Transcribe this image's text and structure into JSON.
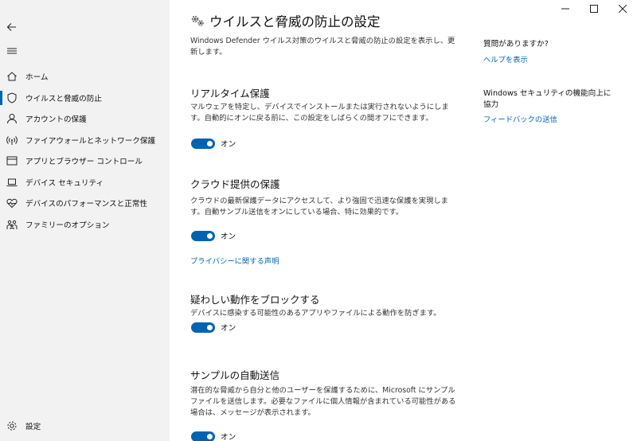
{
  "sidebar": {
    "back_label": "戻る",
    "items": [
      {
        "label": "ホーム",
        "icon": "home-icon"
      },
      {
        "label": "ウイルスと脅威の防止",
        "icon": "shield-icon"
      },
      {
        "label": "アカウントの保護",
        "icon": "person-icon"
      },
      {
        "label": "ファイアウォールとネットワーク保護",
        "icon": "wifi-icon"
      },
      {
        "label": "アプリとブラウザー コントロール",
        "icon": "browser-icon"
      },
      {
        "label": "デバイス セキュリティ",
        "icon": "laptop-icon"
      },
      {
        "label": "デバイスのパフォーマンスと正常性",
        "icon": "heart-icon"
      },
      {
        "label": "ファミリーのオプション",
        "icon": "family-icon"
      }
    ],
    "settings_label": "設定"
  },
  "main": {
    "title": "ウイルスと脅威の防止の設定",
    "description": "Windows Defender ウイルス対策のウイルスと脅威の防止の設定を表示し、更新します。",
    "sections": [
      {
        "title": "リアルタイム保護",
        "description": "マルウェアを特定し、デバイスでインストールまたは実行されないようにします。自動的にオンに戻る前に、この設定をしばらくの間オフにできます。",
        "toggle_label": "オン"
      },
      {
        "title": "クラウド提供の保護",
        "description": "クラウドの最新保護データにアクセスして、より強固で迅速な保護を実現します。自動サンプル送信をオンにしている場合、特に効果的です。",
        "toggle_label": "オン",
        "link": "プライバシーに関する声明"
      },
      {
        "title": "疑わしい動作をブロックする",
        "description": "デバイスに感染する可能性のあるアプリやファイルによる動作を防ぎます。",
        "toggle_label": "オン"
      },
      {
        "title": "サンプルの自動送信",
        "description": "潜在的な脅威から自分と他のユーザーを保護するために、Microsoft にサンプル ファイルを送信します。必要なファイルに個人情報が含まれている可能性がある場合は、メッセージが表示されます。",
        "toggle_label": "オン"
      }
    ]
  },
  "aside": {
    "question_heading": "質問がありますか?",
    "help_link": "ヘルプを表示",
    "feedback_heading": "Windows セキュリティの機能向上に協力",
    "feedback_link": "フィードバックの送信"
  },
  "colors": {
    "accent": "#0063b1",
    "link": "#0067b8",
    "sidebar_bg": "#f2f2f2"
  }
}
